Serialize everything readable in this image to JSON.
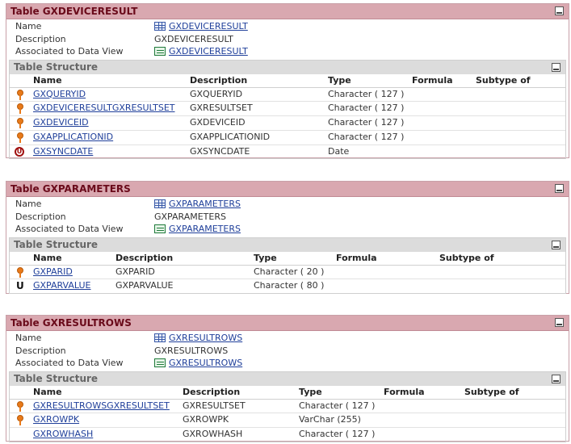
{
  "labels": {
    "name": "Name",
    "description": "Description",
    "associated": "Associated to Data View",
    "structure": "Table Structure",
    "col_name": "Name",
    "col_description": "Description",
    "col_type": "Type",
    "col_formula": "Formula",
    "col_subtype": "Subtype of"
  },
  "tables": [
    {
      "title": "Table GXDEVICERESULT",
      "name": "GXDEVICERESULT",
      "description": "GXDEVICERESULT",
      "data_view": "GXDEVICERESULT",
      "rows": [
        {
          "name": "GXQUERYID",
          "description": "GXQUERYID",
          "type": "Character ( 127 )",
          "icon": "key-icon"
        },
        {
          "name": "GXDEVICERESULTGXRESULTSET",
          "description": "GXRESULTSET",
          "type": "Character ( 127 )",
          "icon": "key-icon"
        },
        {
          "name": "GXDEVICEID",
          "description": "GXDEVICEID",
          "type": "Character ( 127 )",
          "icon": "key-icon"
        },
        {
          "name": "GXAPPLICATIONID",
          "description": "GXAPPLICATIONID",
          "type": "Character ( 127 )",
          "icon": "key-icon"
        },
        {
          "name": "GXSYNCDATE",
          "description": "GXSYNCDATE",
          "type": "Date",
          "icon": "date-index-icon"
        }
      ]
    },
    {
      "title": "Table GXPARAMETERS",
      "name": "GXPARAMETERS",
      "description": "GXPARAMETERS",
      "data_view": "GXPARAMETERS",
      "rows": [
        {
          "name": "GXPARID",
          "description": "GXPARID",
          "type": "Character ( 20 )",
          "icon": "key-icon"
        },
        {
          "name": "GXPARVALUE",
          "description": "GXPARVALUE",
          "type": "Character ( 80 )",
          "icon": "unique-icon"
        }
      ]
    },
    {
      "title": "Table GXRESULTROWS",
      "name": "GXRESULTROWS",
      "description": "GXRESULTROWS",
      "data_view": "GXRESULTROWS",
      "rows": [
        {
          "name": "GXRESULTROWSGXRESULTSET",
          "description": "GXRESULTSET",
          "type": "Character ( 127 )",
          "icon": "key-icon"
        },
        {
          "name": "GXROWPK",
          "description": "GXROWPK",
          "type": "VarChar (255)",
          "icon": "key-icon"
        },
        {
          "name": "GXROWHASH",
          "description": "GXROWHASH",
          "type": "Character ( 127 )",
          "icon": "none"
        }
      ]
    }
  ]
}
